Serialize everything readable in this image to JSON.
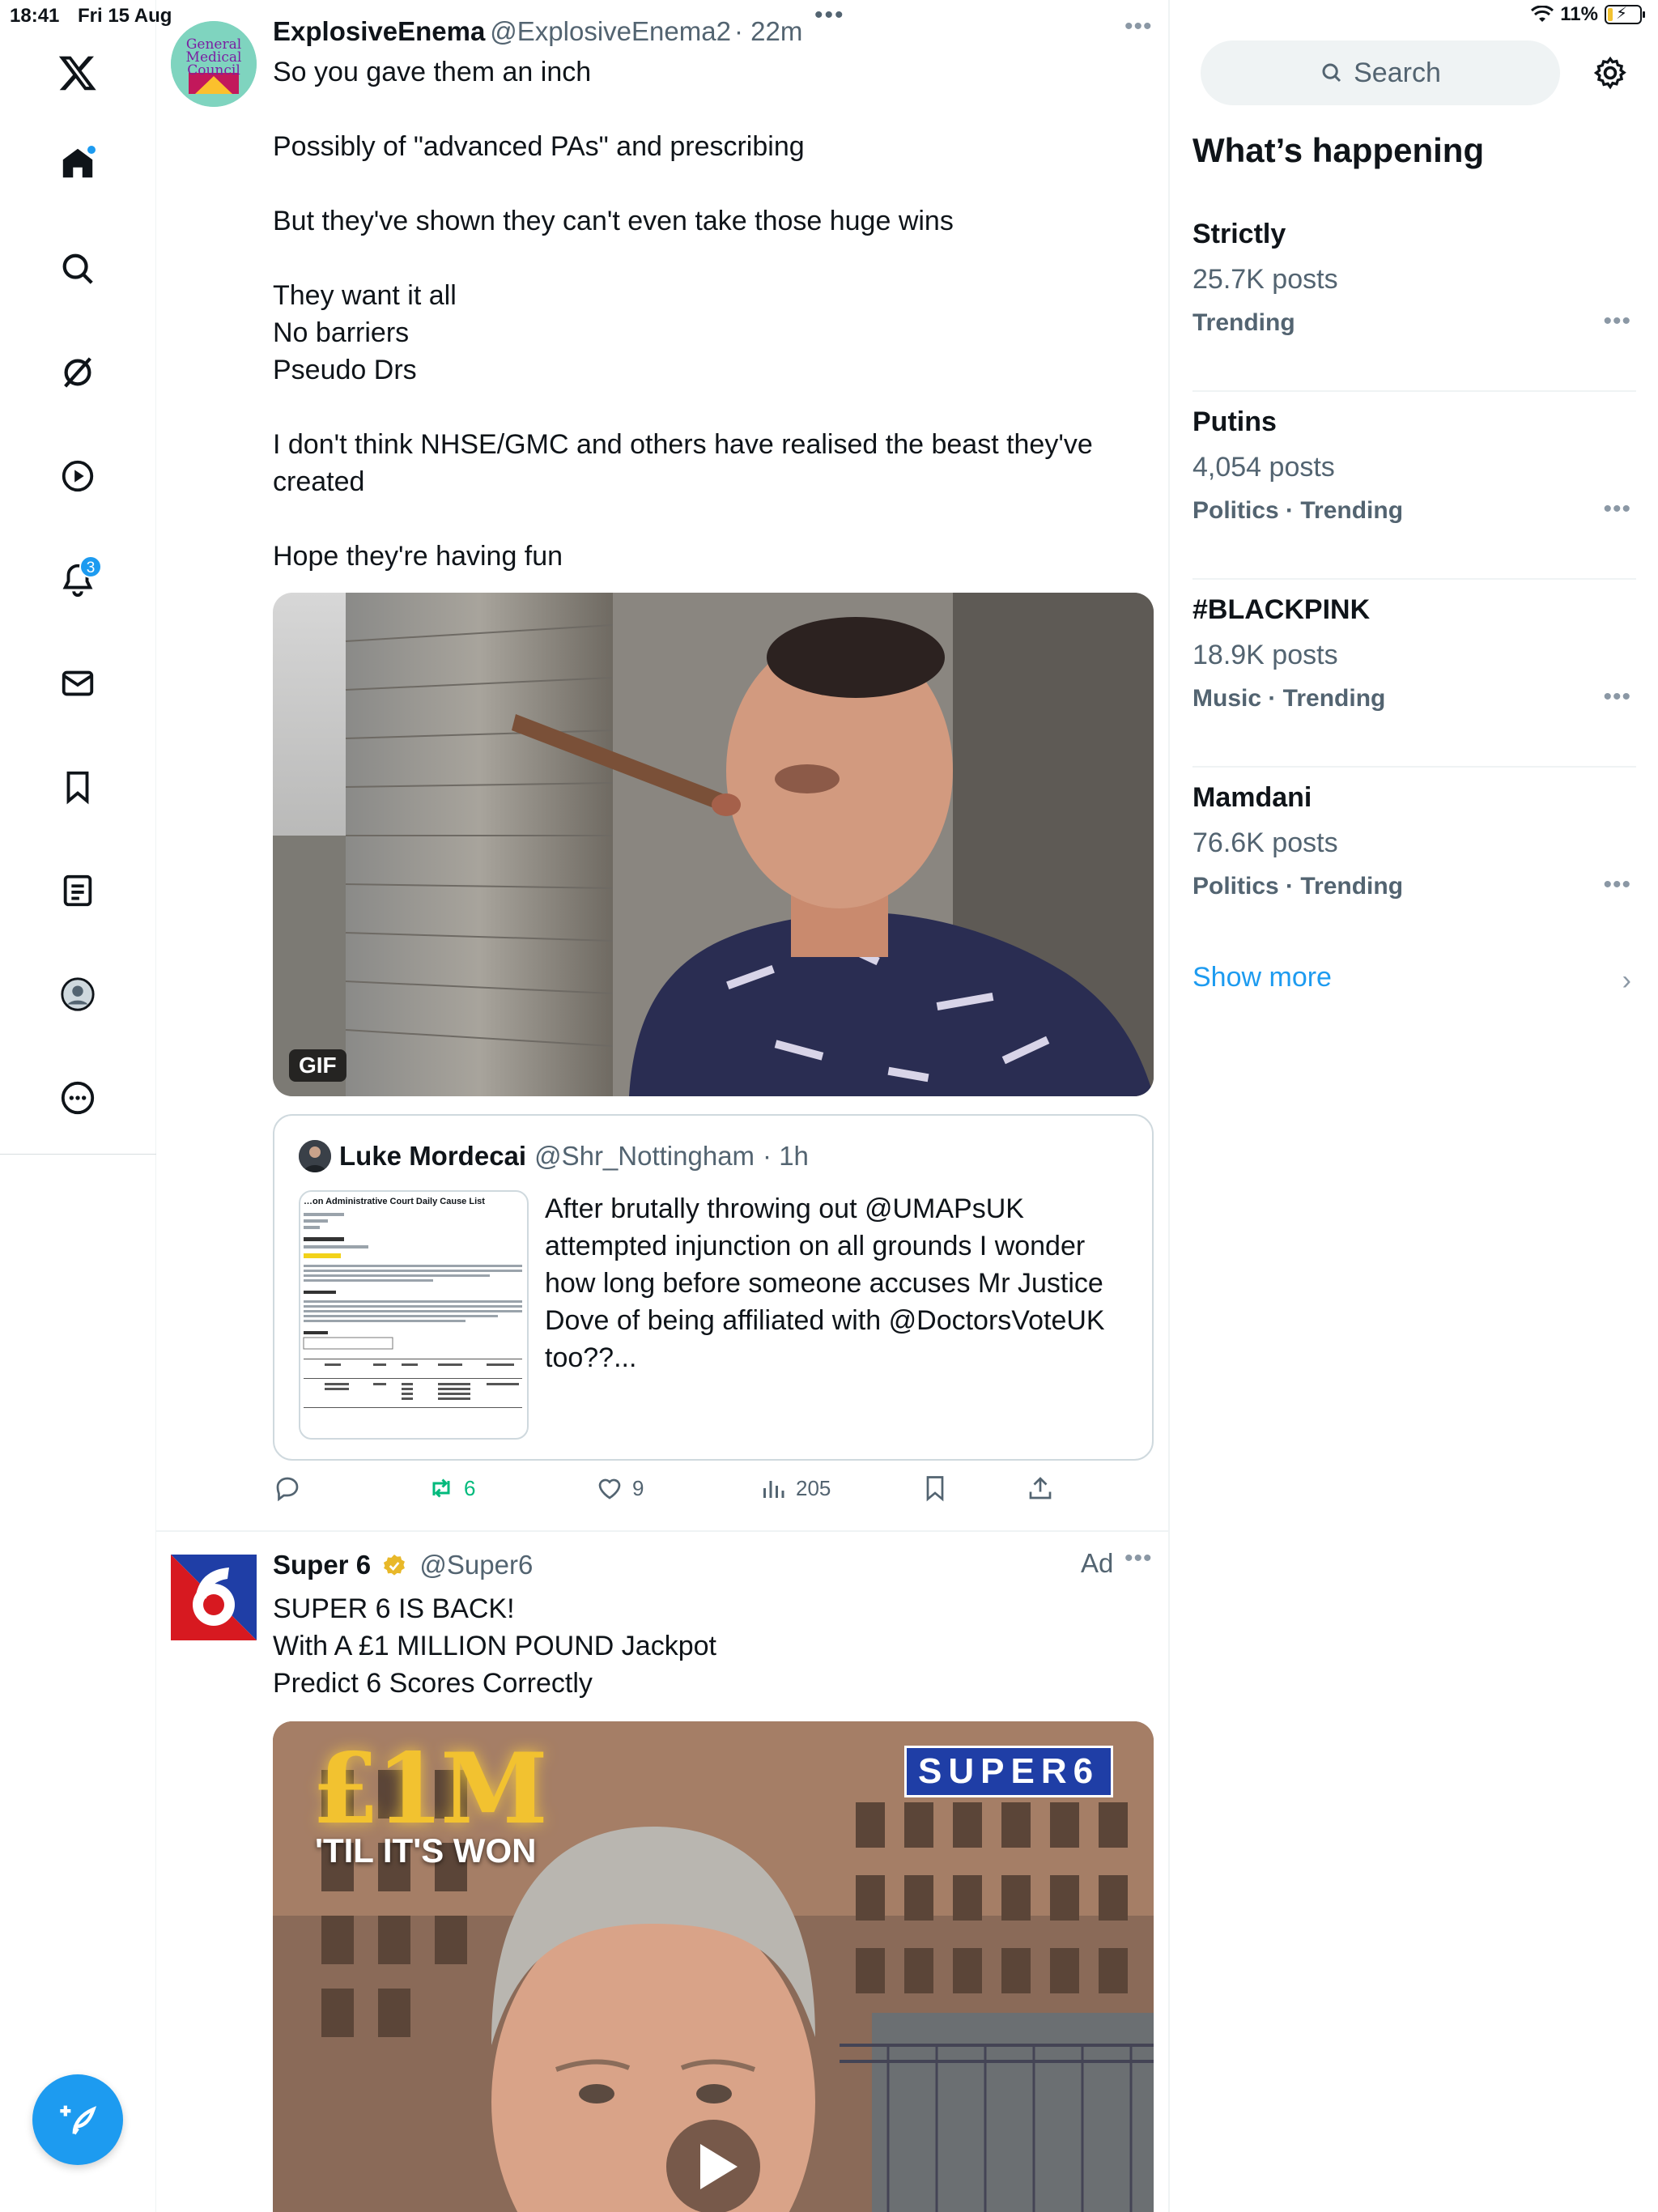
{
  "status_bar": {
    "time": "18:41",
    "date": "Fri 15 Aug",
    "battery": "11%"
  },
  "nav": {
    "logo": "x-logo-icon",
    "items": [
      {
        "icon": "home-icon",
        "badge": ""
      },
      {
        "icon": "search-icon",
        "badge": ""
      },
      {
        "icon": "grok-icon",
        "badge": ""
      },
      {
        "icon": "video-icon",
        "badge": ""
      },
      {
        "icon": "bell-icon",
        "badge": "3"
      },
      {
        "icon": "mail-icon",
        "badge": ""
      },
      {
        "icon": "bookmark-icon",
        "badge": ""
      },
      {
        "icon": "lists-icon",
        "badge": ""
      },
      {
        "icon": "profile-icon",
        "badge": ""
      },
      {
        "icon": "more-icon",
        "badge": ""
      }
    ],
    "compose_icon": "compose-icon"
  },
  "tweet1": {
    "avatar_text": "General Medical Council",
    "name": "ExplosiveEnema",
    "handle": "@ExplosiveEnema2",
    "time": "· 22m",
    "body": [
      "So you gave them an inch",
      "",
      "Possibly of \"advanced PAs\" and prescribing",
      "",
      "But they've shown they can't even take those huge wins",
      "",
      "They want it all",
      "No barriers",
      "Pseudo Drs",
      "",
      "I don't think NHSE/GMC and others have realised the beast they've created",
      "",
      "Hope they're having fun"
    ],
    "media_badge": "GIF",
    "quote": {
      "name": "Luke Mordecai",
      "handle": "@Shr_Nottingham",
      "time": "· 1h",
      "thumb_title": "…on Administrative Court Daily Cause List",
      "text": "After brutally throwing out @UMAPsUK attempted injunction on all grounds I wonder how long before someone accuses Mr Justice Dove of being affiliated with @DoctorsVoteUK too??..."
    },
    "actions": {
      "reply": "",
      "retweet": "6",
      "like": "9",
      "views": "205"
    }
  },
  "tweet2": {
    "name": "Super 6",
    "handle": "@Super6",
    "ad_label": "Ad",
    "body": [
      "SUPER 6 IS BACK!",
      "With A £1 MILLION POUND Jackpot",
      "Predict 6 Scores Correctly"
    ],
    "media_headline": "£1M",
    "media_subline": "'TIL IT'S WON",
    "media_logo": "SUPER6"
  },
  "sidebar": {
    "search_placeholder": "Search",
    "title": "What’s happening",
    "trends": [
      {
        "title": "Strictly",
        "posts": "25.7K posts",
        "category": "Trending"
      },
      {
        "title": "Putins",
        "posts": "4,054 posts",
        "category": "Politics · Trending"
      },
      {
        "title": "#BLACKPINK",
        "posts": "18.9K posts",
        "category": "Music · Trending"
      },
      {
        "title": "Mamdani",
        "posts": "76.6K posts",
        "category": "Politics · Trending"
      }
    ],
    "show_more": "Show more"
  },
  "colors": {
    "accent": "#1d9bf0",
    "retweet": "#00ba7c",
    "text": "#0f1419",
    "muted": "#536471"
  }
}
